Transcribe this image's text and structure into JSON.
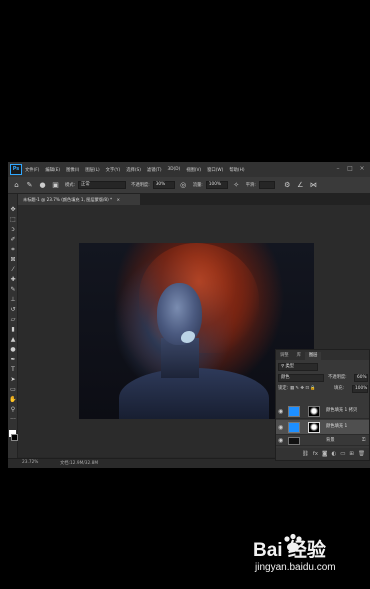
{
  "menubar": {
    "app_icon": "Ps",
    "items": [
      "文件(F)",
      "编辑(E)",
      "图像(I)",
      "图层(L)",
      "文字(Y)",
      "选择(S)",
      "滤镜(T)",
      "3D(D)",
      "视图(V)",
      "窗口(W)",
      "帮助(H)"
    ]
  },
  "options_bar": {
    "mode_label": "模式:",
    "mode_value": "正常",
    "opacity_label": "不透明度:",
    "opacity_value": "30%",
    "flow_label": "流量:",
    "flow_value": "100%",
    "smooth_label": "平滑:"
  },
  "document_tab": {
    "title": "未标题-1 @ 23.7% (颜色填充 1, 图层蒙版/8) *",
    "close": "×"
  },
  "status_bar": {
    "zoom": "23.72%",
    "doc_size": "文档:12.9M/32.8M"
  },
  "layers_panel": {
    "tabs": [
      "调整",
      "库",
      "图层"
    ],
    "active_tab": "图层",
    "filter_value": "类型",
    "blend_mode": "颜色",
    "opacity_label": "不透明度:",
    "opacity_value": "60%",
    "lock_label": "锁定:",
    "fill_label": "填充:",
    "fill_value": "100%",
    "layers": [
      {
        "name": "颜色填充 1 拷贝",
        "visible": true,
        "selected": false,
        "color": "#1e8fff"
      },
      {
        "name": "颜色填充 1",
        "visible": true,
        "selected": true,
        "color": "#1e8fff"
      },
      {
        "name": "背景",
        "visible": true,
        "selected": false,
        "color": "#111111"
      }
    ]
  },
  "watermark": {
    "brand": "Bai 经验",
    "url": "jingyan.baidu.com"
  },
  "colors": {
    "accent": "#31a8ff",
    "fill_layer": "#1e8fff",
    "app_bg": "#282828"
  }
}
